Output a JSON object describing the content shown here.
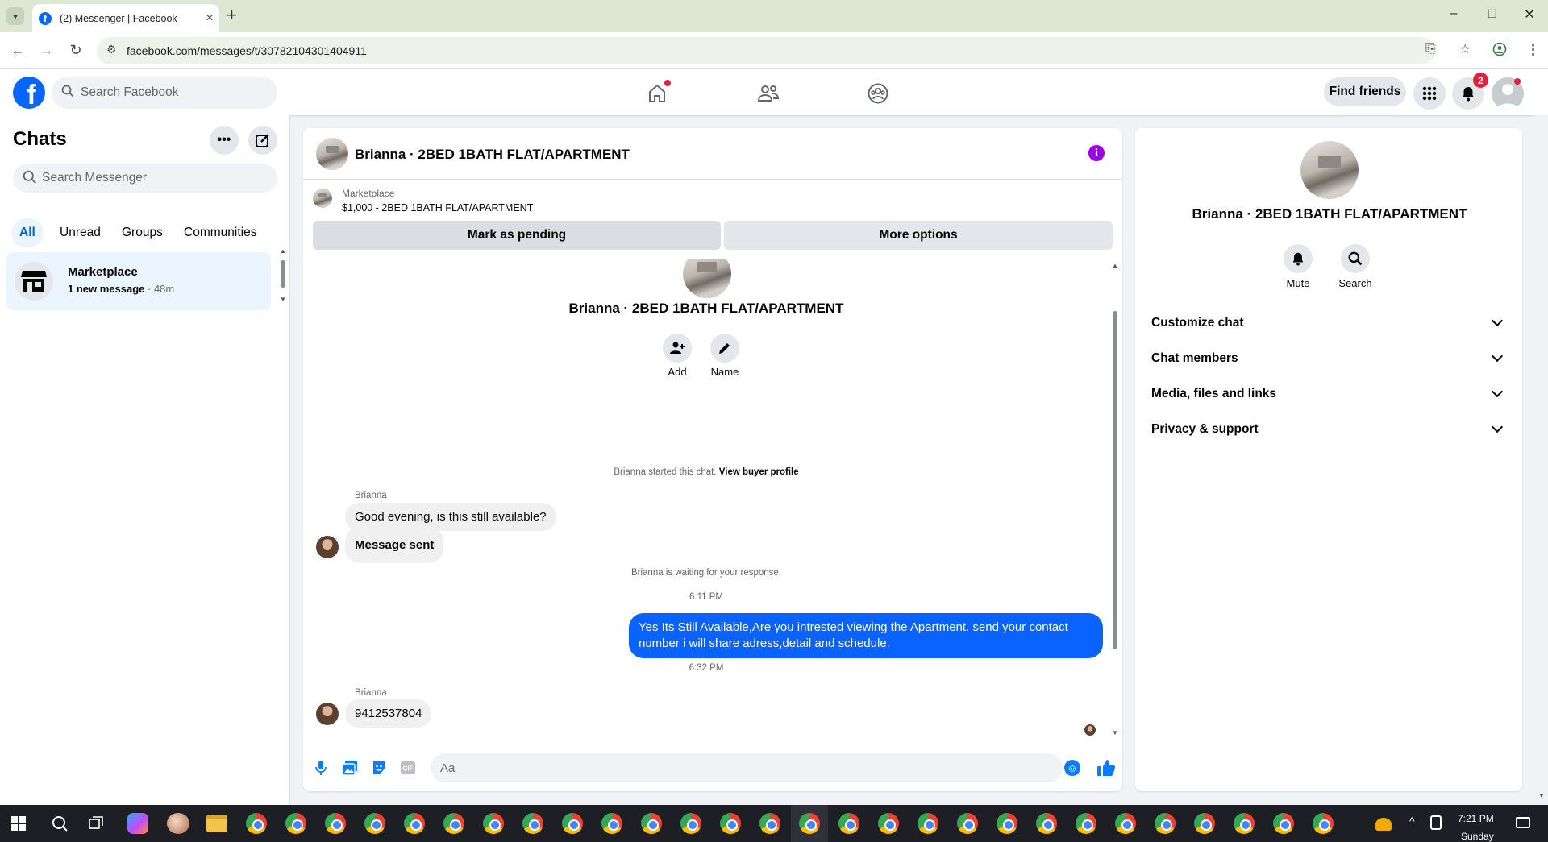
{
  "browser": {
    "tab_title": "(2) Messenger | Facebook",
    "url": "facebook.com/messages/t/30782104301404911"
  },
  "fb": {
    "search_placeholder": "Search Facebook",
    "find_friends": "Find friends",
    "notification_count": "2"
  },
  "chats": {
    "title": "Chats",
    "search_placeholder": "Search Messenger",
    "filters": [
      "All",
      "Unread",
      "Groups",
      "Communities"
    ],
    "items": [
      {
        "name": "Marketplace",
        "preview": "1 new message",
        "time": "· 48m"
      }
    ]
  },
  "conversation": {
    "title": "Brianna · 2BED 1BATH FLAT/APARTMENT",
    "marketplace_label": "Marketplace",
    "marketplace_item": "$1,000 - 2BED 1BATH FLAT/APARTMENT",
    "mark_pending": "Mark as pending",
    "more_options": "More options",
    "intro_name": "Brianna · 2BED 1BATH FLAT/APARTMENT",
    "intro_actions": [
      "Add",
      "Name"
    ],
    "started_text": "Brianna started this chat.",
    "view_profile": "View buyer profile",
    "messages": [
      {
        "sender": "Brianna",
        "text": "Good evening, is this still available?"
      },
      {
        "text": "Message sent"
      },
      {
        "system": "Brianna is waiting for your response."
      },
      {
        "time": "6:11 PM"
      },
      {
        "outgoing": "Yes Its Still Available,Are you intrested viewing the Apartment. send your contact number i will share adress,detail and schedule."
      },
      {
        "time": "6:32 PM"
      },
      {
        "sender": "Brianna",
        "text": "9412537804"
      }
    ],
    "composer_placeholder": "Aa"
  },
  "details": {
    "name": "Brianna · 2BED 1BATH FLAT/APARTMENT",
    "actions": [
      "Mute",
      "Search"
    ],
    "sections": [
      "Customize chat",
      "Chat members",
      "Media, files and links",
      "Privacy & support"
    ]
  },
  "taskbar": {
    "time": "7:21 PM",
    "day": "Sunday"
  },
  "colors": {
    "fb_blue": "#0866ff",
    "outgoing_bubble": "#0a62ff",
    "info_purple": "#9b00e8",
    "badge_red": "#e41e3f"
  }
}
